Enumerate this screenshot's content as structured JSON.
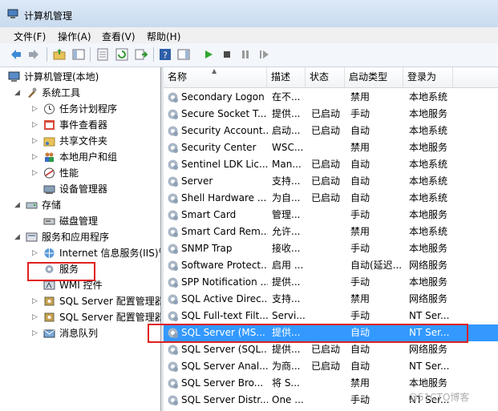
{
  "window": {
    "title": "计算机管理"
  },
  "menu": [
    "文件(F)",
    "操作(A)",
    "查看(V)",
    "帮助(H)"
  ],
  "tree": {
    "root": "计算机管理(本地)",
    "system_tools": "系统工具",
    "task_scheduler": "任务计划程序",
    "event_viewer": "事件查看器",
    "shared_folders": "共享文件夹",
    "local_users": "本地用户和组",
    "performance": "性能",
    "device_manager": "设备管理器",
    "storage": "存储",
    "disk_management": "磁盘管理",
    "services_apps": "服务和应用程序",
    "iis": "Internet 信息服务(IIS)管",
    "services": "服务",
    "wmi": "WMI 控件",
    "sql_config_1": "SQL Server 配置管理器",
    "sql_config_2": "SQL Server 配置管理器",
    "message_queue": "消息队列"
  },
  "table": {
    "headers": {
      "name": "名称",
      "desc": "描述",
      "status": "状态",
      "startup": "启动类型",
      "logon": "登录为"
    },
    "rows": [
      {
        "name": "Secondary Logon",
        "desc": "在不...",
        "status": "",
        "startup": "禁用",
        "logon": "本地系统"
      },
      {
        "name": "Secure Socket T...",
        "desc": "提供...",
        "status": "已启动",
        "startup": "手动",
        "logon": "本地服务"
      },
      {
        "name": "Security Account...",
        "desc": "启动...",
        "status": "已启动",
        "startup": "自动",
        "logon": "本地系统"
      },
      {
        "name": "Security Center",
        "desc": "WSC...",
        "status": "",
        "startup": "禁用",
        "logon": "本地服务"
      },
      {
        "name": "Sentinel LDK Lic...",
        "desc": "Man...",
        "status": "已启动",
        "startup": "自动",
        "logon": "本地系统"
      },
      {
        "name": "Server",
        "desc": "支持...",
        "status": "已启动",
        "startup": "自动",
        "logon": "本地系统"
      },
      {
        "name": "Shell Hardware ...",
        "desc": "为自...",
        "status": "已启动",
        "startup": "自动",
        "logon": "本地系统"
      },
      {
        "name": "Smart Card",
        "desc": "管理...",
        "status": "",
        "startup": "手动",
        "logon": "本地服务"
      },
      {
        "name": "Smart Card Rem...",
        "desc": "允许...",
        "status": "",
        "startup": "禁用",
        "logon": "本地系统"
      },
      {
        "name": "SNMP Trap",
        "desc": "接收...",
        "status": "",
        "startup": "手动",
        "logon": "本地服务"
      },
      {
        "name": "Software Protect...",
        "desc": "启用 ...",
        "status": "",
        "startup": "自动(延迟...",
        "logon": "网络服务"
      },
      {
        "name": "SPP Notification ...",
        "desc": "提供...",
        "status": "",
        "startup": "手动",
        "logon": "本地服务"
      },
      {
        "name": "SQL Active Direc...",
        "desc": "支持...",
        "status": "",
        "startup": "禁用",
        "logon": "网络服务"
      },
      {
        "name": "SQL Full-text Filt...",
        "desc": "Servi...",
        "status": "",
        "startup": "手动",
        "logon": "NT Ser..."
      },
      {
        "name": "SQL Server (MS...",
        "desc": "提供...",
        "status": "",
        "startup": "自动",
        "logon": "NT Ser..."
      },
      {
        "name": "SQL Server (SQL...",
        "desc": "提供...",
        "status": "已启动",
        "startup": "自动",
        "logon": "网络服务"
      },
      {
        "name": "SQL Server Anal...",
        "desc": "为商...",
        "status": "已启动",
        "startup": "自动",
        "logon": "NT Ser..."
      },
      {
        "name": "SQL Server Bro...",
        "desc": "将 S...",
        "status": "",
        "startup": "禁用",
        "logon": "本地服务"
      },
      {
        "name": "SQL Server Distr...",
        "desc": "One ...",
        "status": "",
        "startup": "手动",
        "logon": "NT Ser..."
      }
    ]
  },
  "watermark": "@51CTO博客",
  "colors": {
    "selection": "#3399ff",
    "highlight_box": "#e02020"
  }
}
